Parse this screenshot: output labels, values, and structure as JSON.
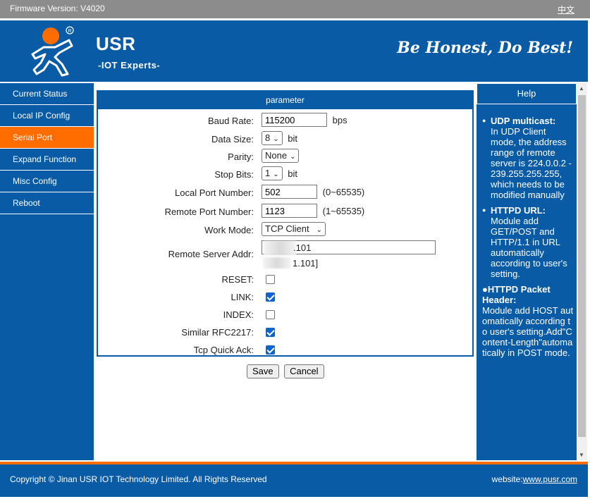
{
  "topbar": {
    "firmware": "Firmware Version:  V4020",
    "language": "中文"
  },
  "header": {
    "brand": "USR",
    "subtitle": "-IOT Experts-",
    "slogan": "Be Honest, Do Best!"
  },
  "sidebar": {
    "items": [
      {
        "label": "Current Status"
      },
      {
        "label": "Local IP Config"
      },
      {
        "label": "Serial Port",
        "active": true
      },
      {
        "label": "Expand Function"
      },
      {
        "label": "Misc Config"
      },
      {
        "label": "Reboot"
      }
    ]
  },
  "form": {
    "title": "parameter",
    "baud_label": "Baud Rate:",
    "baud_value": "115200",
    "baud_unit": "bps",
    "data_size_label": "Data Size:",
    "data_size_value": "8",
    "data_size_unit": "bit",
    "parity_label": "Parity:",
    "parity_value": "None",
    "stop_bits_label": "Stop Bits:",
    "stop_bits_value": "1",
    "stop_bits_unit": "bit",
    "local_port_label": "Local Port Number:",
    "local_port_value": "502",
    "local_port_range": "(0~65535)",
    "remote_port_label": "Remote Port Number:",
    "remote_port_value": "1123",
    "remote_port_range": "(1~65535)",
    "work_mode_label": "Work Mode:",
    "work_mode_value": "TCP Client",
    "server_addr_label": "Remote Server Addr:",
    "server_addr_value": ".101",
    "server_addr_echo": "1.101]",
    "reset_label": "RESET:",
    "link_label": "LINK:",
    "index_label": "INDEX:",
    "rfc_label": "Similar RFC2217:",
    "quick_ack_label": "Tcp Quick Ack:"
  },
  "buttons": {
    "save": "Save",
    "cancel": "Cancel"
  },
  "help": {
    "title": "Help",
    "udp_title": "UDP multicast:",
    "udp_text": "In UDP Client mode, the address range of remote server is 224.0.0.2 - 239.255.255.255, which needs to be modified manually",
    "httpd_title": "HTTPD URL:",
    "httpd_text": "Module add GET/POST and HTTP/1.1 in URL automatically according to user's setting.",
    "header_title": "●HTTPD Packet Header:",
    "header_text": "Module add HOST automatically according to user's setting.Add\"Content-Length\"automatically in POST mode."
  },
  "footer": {
    "copyright": "Copyright © Jinan USR IOT Technology Limited. All Rights Reserved",
    "website_label": "website:",
    "website_url": "www.pusr.com"
  }
}
